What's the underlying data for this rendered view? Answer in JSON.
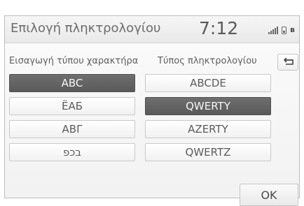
{
  "header": {
    "title": "Επιλογή πληκτρολογίου",
    "clock": "7:12",
    "icons": [
      "signal-icon",
      "phone-icon",
      "bluetooth-icon"
    ]
  },
  "left_column": {
    "heading": "Εισαγωγή τύπου χαρακτήρα",
    "options": [
      {
        "label": "ABC",
        "selected": true
      },
      {
        "label": "ËAБ",
        "selected": false
      },
      {
        "label": "ABΓ",
        "selected": false
      },
      {
        "label": "בכפ",
        "selected": false
      }
    ]
  },
  "right_column": {
    "heading": "Τύπος πληκτρολογίου",
    "options": [
      {
        "label": "ABCDE",
        "selected": false
      },
      {
        "label": "QWERTY",
        "selected": true
      },
      {
        "label": "AZERTY",
        "selected": false
      },
      {
        "label": "QWERTZ",
        "selected": false
      }
    ]
  },
  "footer": {
    "ok_label": "OK"
  },
  "colors": {
    "selected": "#5f5f5f",
    "button": "#f6f6f6",
    "text": "#5b5b5b"
  }
}
